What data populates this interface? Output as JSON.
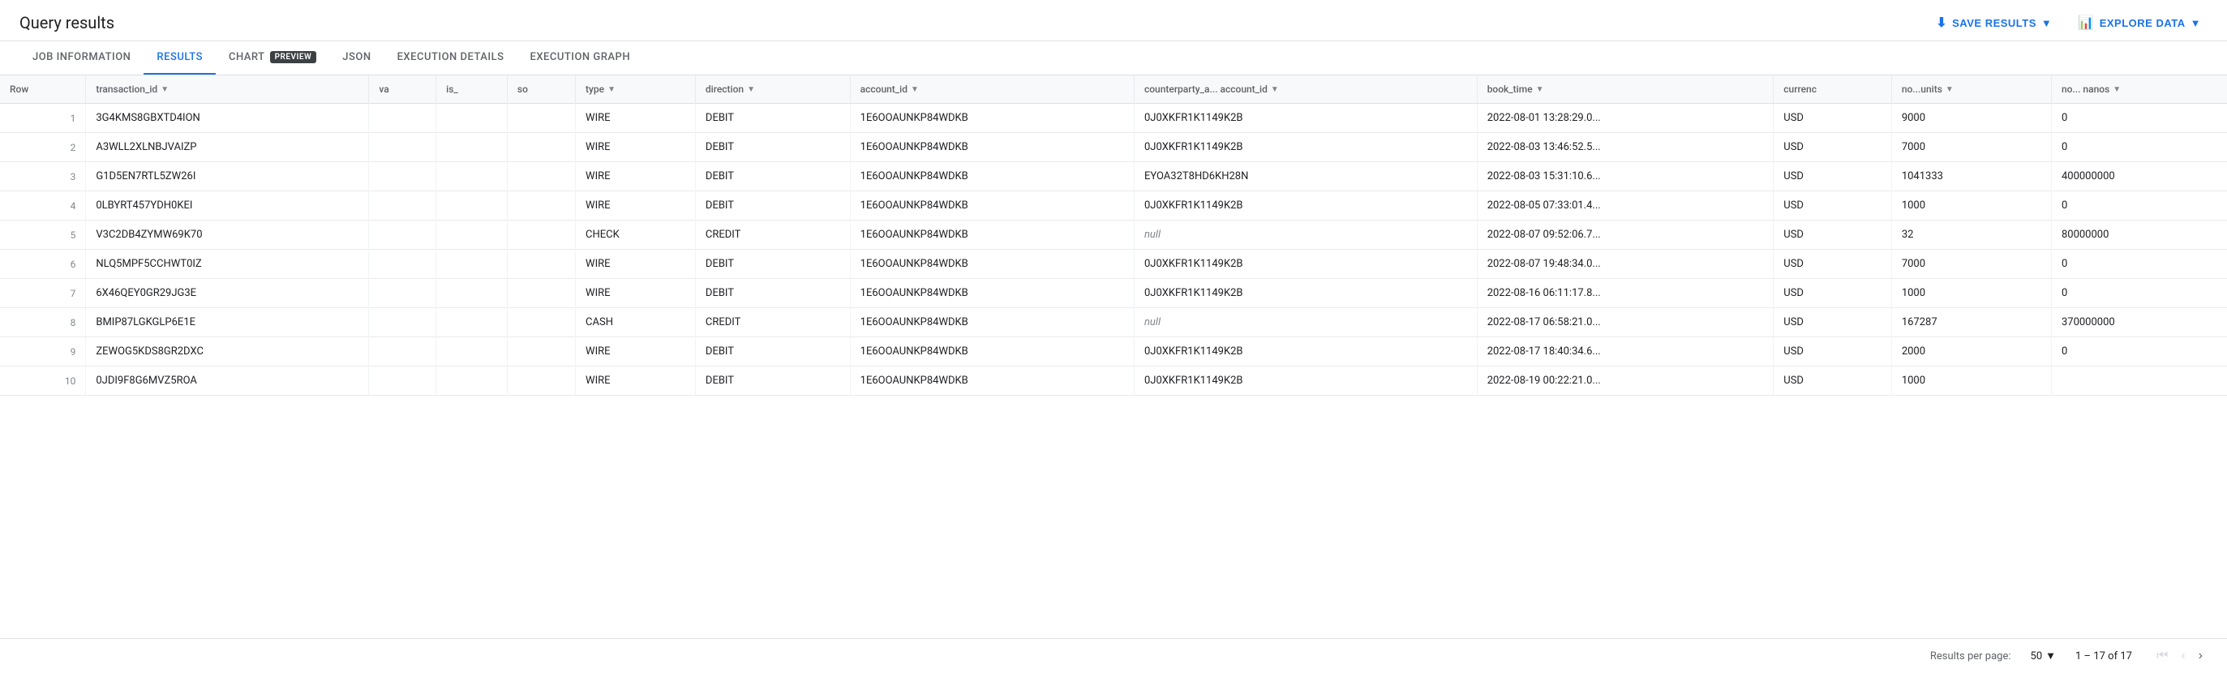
{
  "page": {
    "title": "Query results"
  },
  "header_actions": {
    "save_results": "SAVE RESULTS",
    "explore_data": "EXPLORE DATA"
  },
  "tabs": [
    {
      "id": "job-information",
      "label": "JOB INFORMATION",
      "active": false
    },
    {
      "id": "results",
      "label": "RESULTS",
      "active": true
    },
    {
      "id": "chart",
      "label": "CHART",
      "active": false,
      "preview": true
    },
    {
      "id": "json",
      "label": "JSON",
      "active": false
    },
    {
      "id": "execution-details",
      "label": "EXECUTION DETAILS",
      "active": false
    },
    {
      "id": "execution-graph",
      "label": "EXECUTION GRAPH",
      "active": false
    }
  ],
  "preview_badge": "PREVIEW",
  "table": {
    "columns": [
      {
        "id": "row",
        "label": "Row"
      },
      {
        "id": "transaction_id",
        "label": "transaction_id",
        "sortable": true
      },
      {
        "id": "va",
        "label": "va",
        "sortable": false
      },
      {
        "id": "is",
        "label": "is_",
        "sortable": false
      },
      {
        "id": "so",
        "label": "so",
        "sortable": false
      },
      {
        "id": "type",
        "label": "type",
        "sortable": true
      },
      {
        "id": "direction",
        "label": "direction",
        "sortable": true
      },
      {
        "id": "account_id",
        "label": "account_id",
        "sortable": true
      },
      {
        "id": "counterparty_a_account_id",
        "label": "counterparty_a... account_id",
        "sortable": true
      },
      {
        "id": "book_time",
        "label": "book_time",
        "sortable": true
      },
      {
        "id": "currency",
        "label": "currenc",
        "sortable": false
      },
      {
        "id": "no_units",
        "label": "no...units",
        "sortable": true
      },
      {
        "id": "no_nanos",
        "label": "no... nanos",
        "sortable": true
      }
    ],
    "rows": [
      {
        "row": 1,
        "transaction_id": "3G4KMS8GBXTD4ION",
        "va": "",
        "is_": "",
        "so": "",
        "type": "WIRE",
        "direction": "DEBIT",
        "account_id": "1E6OOAUNKP84WDKB",
        "counterparty_a_account_id": "0J0XKFR1K1149K2B",
        "book_time": "2022-08-01 13:28:29.0...",
        "currency": "USD",
        "no_units": "9000",
        "no_nanos": "0"
      },
      {
        "row": 2,
        "transaction_id": "A3WLL2XLNBJVAIZP",
        "va": "",
        "is_": "",
        "so": "",
        "type": "WIRE",
        "direction": "DEBIT",
        "account_id": "1E6OOAUNKP84WDKB",
        "counterparty_a_account_id": "0J0XKFR1K1149K2B",
        "book_time": "2022-08-03 13:46:52.5...",
        "currency": "USD",
        "no_units": "7000",
        "no_nanos": "0"
      },
      {
        "row": 3,
        "transaction_id": "G1D5EN7RTL5ZW26I",
        "va": "",
        "is_": "",
        "so": "",
        "type": "WIRE",
        "direction": "DEBIT",
        "account_id": "1E6OOAUNKP84WDKB",
        "counterparty_a_account_id": "EYOA32T8HD6KH28N",
        "book_time": "2022-08-03 15:31:10.6...",
        "currency": "USD",
        "no_units": "1041333",
        "no_nanos": "400000000"
      },
      {
        "row": 4,
        "transaction_id": "0LBYRT457YDH0KEI",
        "va": "",
        "is_": "",
        "so": "",
        "type": "WIRE",
        "direction": "DEBIT",
        "account_id": "1E6OOAUNKP84WDKB",
        "counterparty_a_account_id": "0J0XKFR1K1149K2B",
        "book_time": "2022-08-05 07:33:01.4...",
        "currency": "USD",
        "no_units": "1000",
        "no_nanos": "0"
      },
      {
        "row": 5,
        "transaction_id": "V3C2DB4ZYMW69K70",
        "va": "",
        "is_": "",
        "so": "",
        "type": "CHECK",
        "direction": "CREDIT",
        "account_id": "1E6OOAUNKP84WDKB",
        "counterparty_a_account_id": null,
        "book_time": "2022-08-07 09:52:06.7...",
        "currency": "USD",
        "no_units": "32",
        "no_nanos": "80000000"
      },
      {
        "row": 6,
        "transaction_id": "NLQ5MPF5CCHWT0IZ",
        "va": "",
        "is_": "",
        "so": "",
        "type": "WIRE",
        "direction": "DEBIT",
        "account_id": "1E6OOAUNKP84WDKB",
        "counterparty_a_account_id": "0J0XKFR1K1149K2B",
        "book_time": "2022-08-07 19:48:34.0...",
        "currency": "USD",
        "no_units": "7000",
        "no_nanos": "0"
      },
      {
        "row": 7,
        "transaction_id": "6X46QEY0GR29JG3E",
        "va": "",
        "is_": "",
        "so": "",
        "type": "WIRE",
        "direction": "DEBIT",
        "account_id": "1E6OOAUNKP84WDKB",
        "counterparty_a_account_id": "0J0XKFR1K1149K2B",
        "book_time": "2022-08-16 06:11:17.8...",
        "currency": "USD",
        "no_units": "1000",
        "no_nanos": "0"
      },
      {
        "row": 8,
        "transaction_id": "BMIP87LGKGLP6E1E",
        "va": "",
        "is_": "",
        "so": "",
        "type": "CASH",
        "direction": "CREDIT",
        "account_id": "1E6OOAUNKP84WDKB",
        "counterparty_a_account_id": null,
        "book_time": "2022-08-17 06:58:21.0...",
        "currency": "USD",
        "no_units": "167287",
        "no_nanos": "370000000"
      },
      {
        "row": 9,
        "transaction_id": "ZEWOG5KDS8GR2DXC",
        "va": "",
        "is_": "",
        "so": "",
        "type": "WIRE",
        "direction": "DEBIT",
        "account_id": "1E6OOAUNKP84WDKB",
        "counterparty_a_account_id": "0J0XKFR1K1149K2B",
        "book_time": "2022-08-17 18:40:34.6...",
        "currency": "USD",
        "no_units": "2000",
        "no_nanos": "0"
      },
      {
        "row": 10,
        "transaction_id": "0JDI9F8G6MVZ5ROA",
        "va": "",
        "is_": "",
        "so": "",
        "type": "WIRE",
        "direction": "DEBIT",
        "account_id": "1E6OOAUNKP84WDKB",
        "counterparty_a_account_id": "0J0XKFR1K1149K2B",
        "book_time": "2022-08-19 00:22:21.0...",
        "currency": "USD",
        "no_units": "1000",
        "no_nanos": ""
      }
    ]
  },
  "footer": {
    "results_per_page_label": "Results per page:",
    "per_page_value": "50",
    "range": "1 – 17 of 17"
  }
}
